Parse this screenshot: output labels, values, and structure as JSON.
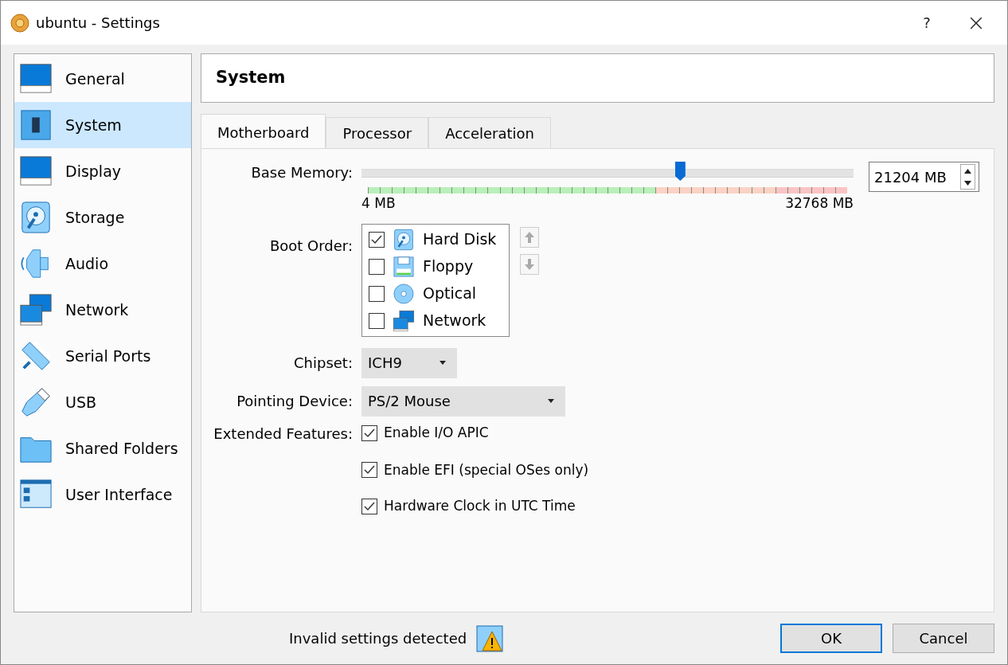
{
  "window": {
    "title": "ubuntu - Settings",
    "help": "?",
    "close": "×"
  },
  "sidebar": {
    "items": [
      {
        "label": "General",
        "kind": "monitor",
        "selected": false
      },
      {
        "label": "System",
        "kind": "chip",
        "selected": true
      },
      {
        "label": "Display",
        "kind": "monitor",
        "selected": false
      },
      {
        "label": "Storage",
        "kind": "disk",
        "selected": false
      },
      {
        "label": "Audio",
        "kind": "speaker",
        "selected": false
      },
      {
        "label": "Network",
        "kind": "network",
        "selected": false
      },
      {
        "label": "Serial Ports",
        "kind": "serial",
        "selected": false
      },
      {
        "label": "USB",
        "kind": "usb",
        "selected": false
      },
      {
        "label": "Shared Folders",
        "kind": "folder",
        "selected": false
      },
      {
        "label": "User Interface",
        "kind": "ui",
        "selected": false
      }
    ]
  },
  "page_title": "System",
  "tabs": [
    {
      "label": "Motherboard",
      "selected": true
    },
    {
      "label": "Processor",
      "selected": false
    },
    {
      "label": "Acceleration",
      "selected": false
    }
  ],
  "base_memory": {
    "label": "Base Memory:",
    "level": 0.647,
    "min": "4 MB",
    "max": "32768 MB",
    "value": "21204 MB"
  },
  "boot_order": {
    "label": "Boot Order:",
    "items": [
      {
        "label": "Hard Disk",
        "kind": "disk",
        "checked": true
      },
      {
        "label": "Floppy",
        "kind": "floppy",
        "checked": false
      },
      {
        "label": "Optical",
        "kind": "optical",
        "checked": false
      },
      {
        "label": "Network",
        "kind": "network",
        "checked": false
      }
    ]
  },
  "chipset": {
    "label": "Chipset:",
    "value": "ICH9"
  },
  "pointing_device": {
    "label": "Pointing Device:",
    "value": "PS/2 Mouse"
  },
  "extended_features": {
    "label": "Extended Features:",
    "items": [
      {
        "label": "Enable I/O APIC",
        "checked": true
      },
      {
        "label": "Enable EFI (special OSes only)",
        "checked": true
      },
      {
        "label": "Hardware Clock in UTC Time",
        "checked": true
      }
    ]
  },
  "status": {
    "message": "Invalid settings detected"
  },
  "buttons": [
    {
      "label": "OK",
      "default": true
    },
    {
      "label": "Cancel",
      "default": false
    }
  ]
}
